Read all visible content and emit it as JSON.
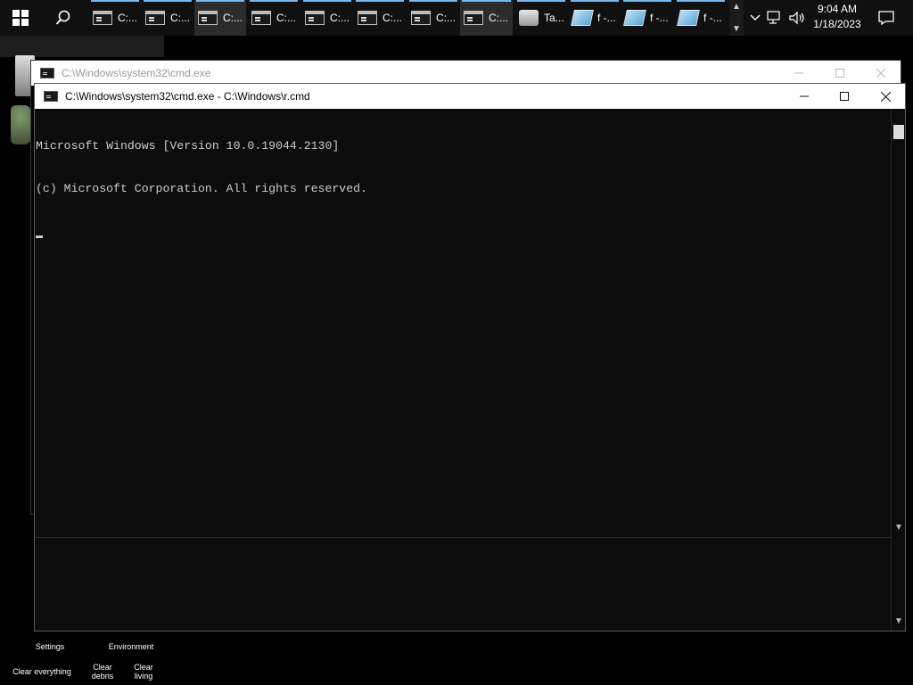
{
  "taskbar": {
    "items": [
      {
        "label": "C:...",
        "icon": "cmd-icon"
      },
      {
        "label": "C:...",
        "icon": "cmd-icon"
      },
      {
        "label": "C:...",
        "icon": "cmd-icon"
      },
      {
        "label": "C:...",
        "icon": "cmd-icon"
      },
      {
        "label": "C:...",
        "icon": "cmd-icon"
      },
      {
        "label": "C:...",
        "icon": "cmd-icon"
      },
      {
        "label": "C:...",
        "icon": "cmd-icon"
      },
      {
        "label": "C:...",
        "icon": "cmd-icon"
      },
      {
        "label": "Ta...",
        "icon": "task-manager-icon"
      },
      {
        "label": "f -...",
        "icon": "document-icon"
      },
      {
        "label": "f -...",
        "icon": "document-icon"
      },
      {
        "label": "f -...",
        "icon": "document-icon"
      }
    ],
    "clock_time": "9:04 AM",
    "clock_date": "1/18/2023"
  },
  "back_window": {
    "title": "C:\\Windows\\system32\\cmd.exe"
  },
  "front_window": {
    "title": "C:\\Windows\\system32\\cmd.exe - C:\\Windows\\r.cmd",
    "line1": "Microsoft Windows [Version 10.0.19044.2130]",
    "line2": "(c) Microsoft Corporation. All rights reserved."
  },
  "bottom_tools": {
    "settings": "Settings",
    "environment": "Environment",
    "clear_everything": "Clear everything",
    "clear_debris_1": "Clear",
    "clear_debris_2": "debris",
    "clear_living_1": "Clear",
    "clear_living_2": "living"
  },
  "colors": {
    "accent": "#76b9ed",
    "console_text": "#cccccc",
    "console_bg": "#0c0c0c"
  }
}
